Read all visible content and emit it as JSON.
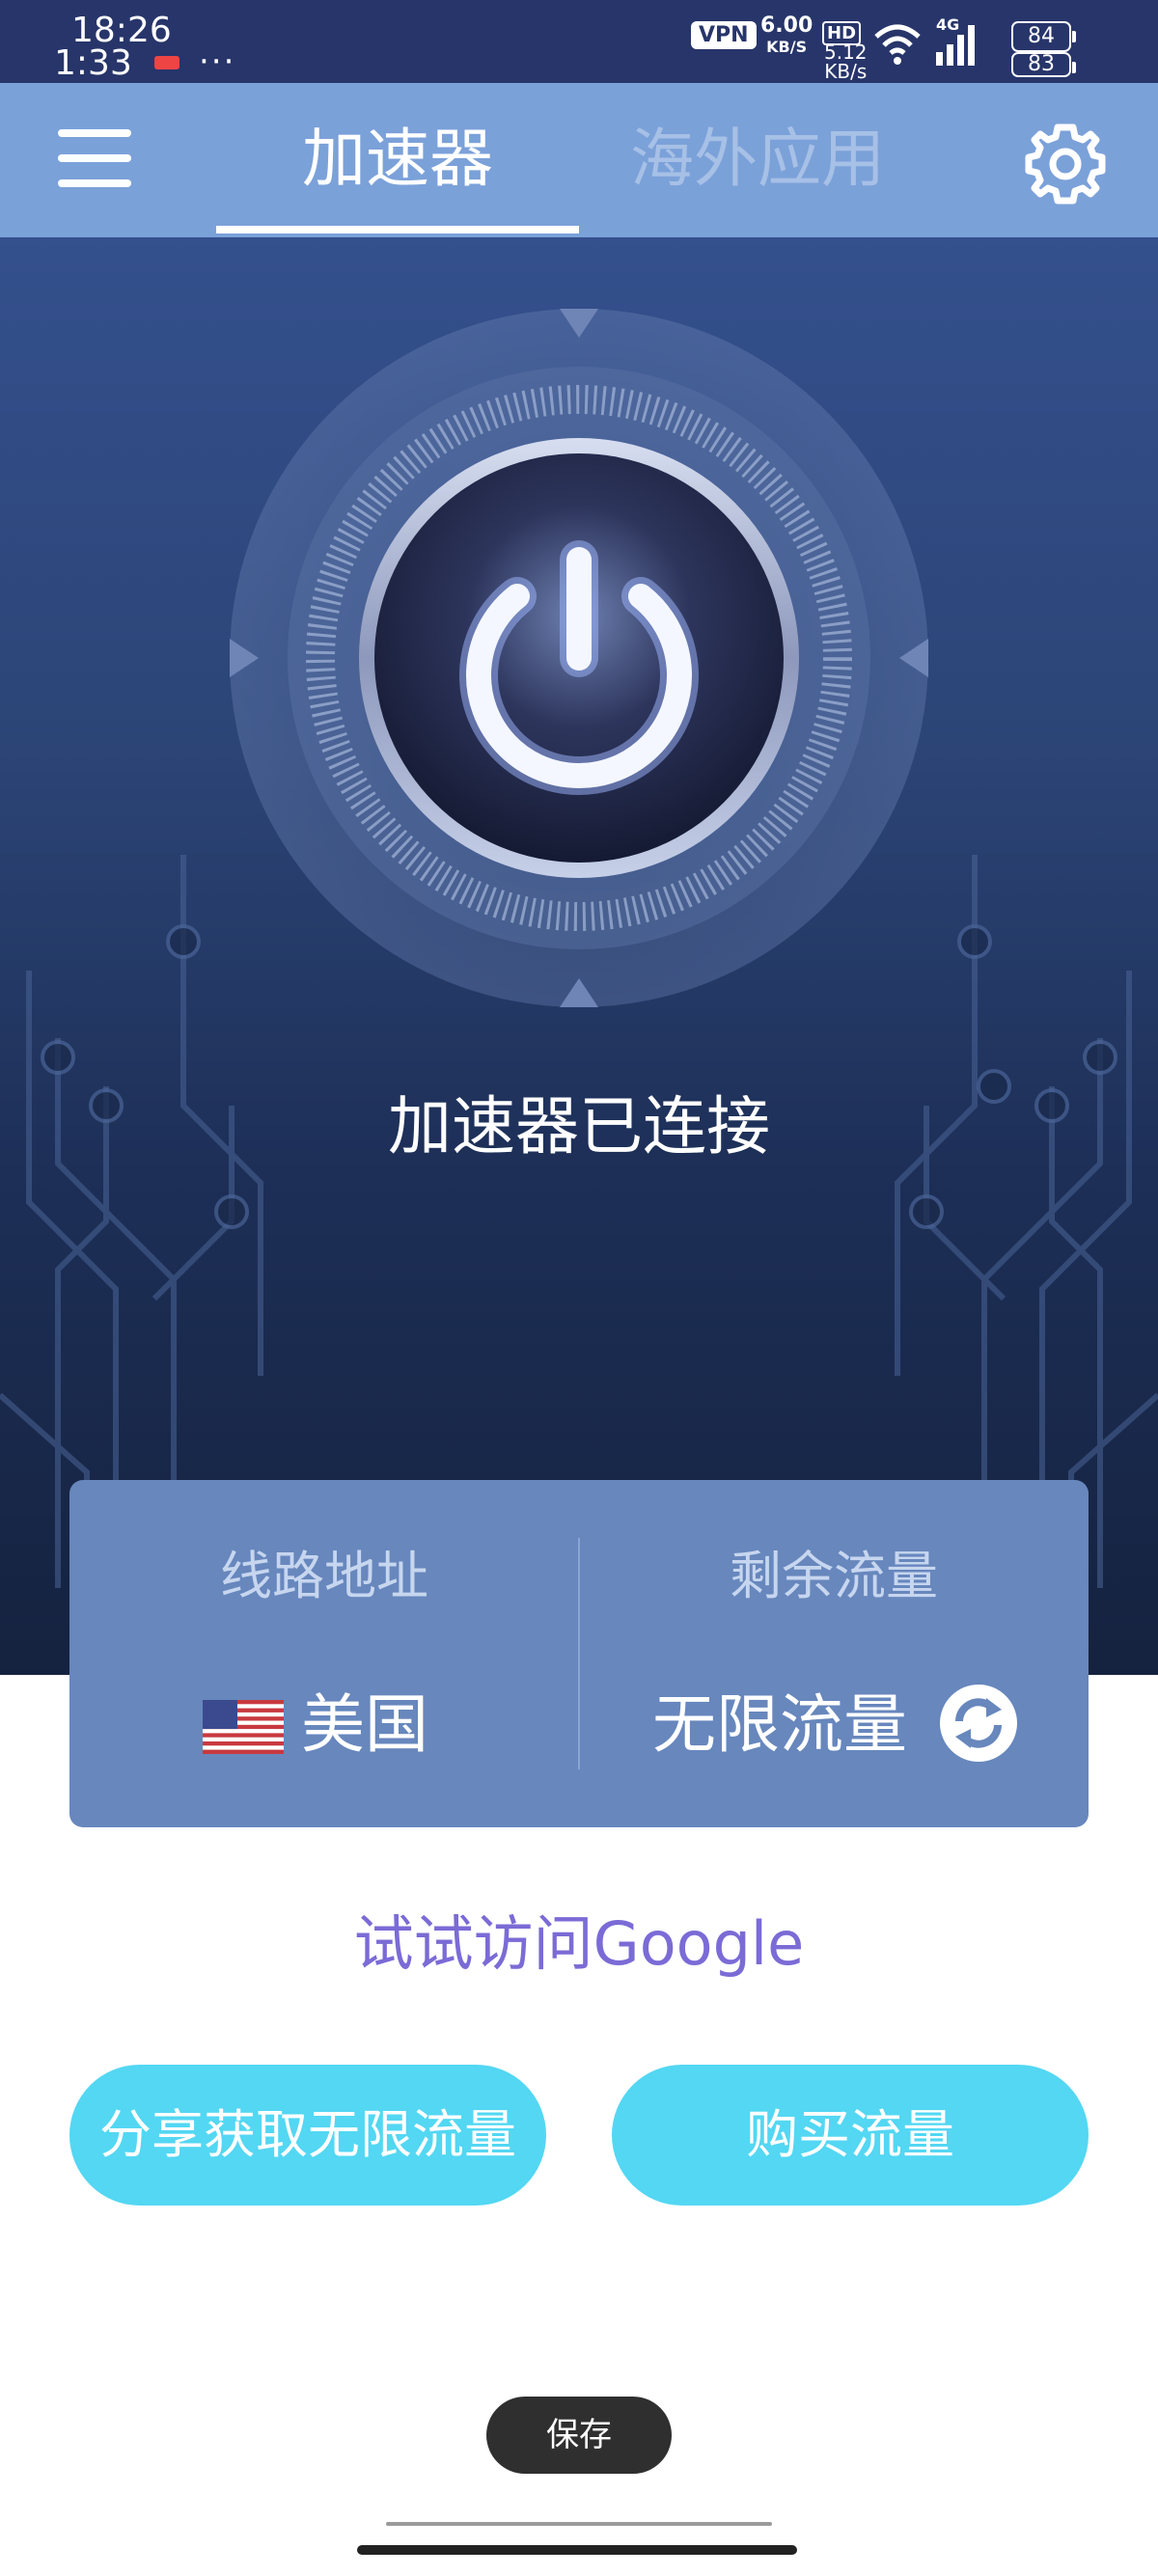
{
  "status_bar": {
    "time_primary": "18:26",
    "time_secondary": "1:33",
    "dots": "···",
    "vpn_badge": "VPN",
    "speed_value": "6.00",
    "speed_unit": "KB/S",
    "speed2_value": "5.12",
    "speed2_unit": "KB/s",
    "hd_label": "HD",
    "network_label": "4G",
    "battery_1": "84",
    "battery_2": "83"
  },
  "header": {
    "tabs": [
      {
        "label": "加速器",
        "active": true
      },
      {
        "label": "海外应用",
        "active": false
      }
    ],
    "menu_icon": "hamburger-menu-icon",
    "settings_icon": "gear-icon"
  },
  "main": {
    "power_icon": "power-icon",
    "status_text": "加速器已连接"
  },
  "info_card": {
    "route_label": "线路地址",
    "route_value": "美国",
    "route_flag": "us-flag-icon",
    "traffic_label": "剩余流量",
    "traffic_value": "无限流量",
    "refresh_icon": "refresh-icon"
  },
  "links": {
    "try_google": "试试访问Google"
  },
  "buttons": {
    "share_label": "分享获取无限流量",
    "buy_label": "购买流量"
  },
  "overlay": {
    "save_label": "保存"
  },
  "colors": {
    "status_bar": "#27356a",
    "top_bar": "#7ba1d9",
    "card": "#6787bd",
    "button": "#53d7f3",
    "link": "#7b6bd6"
  }
}
